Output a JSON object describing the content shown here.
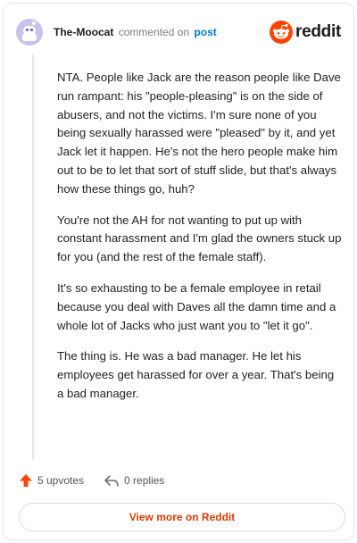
{
  "header": {
    "author": "The-Moocat",
    "action": "commented on",
    "post_link": "post",
    "brand": "reddit",
    "avatar_icon": "snoo-avatar-icon",
    "brand_icon": "reddit-logo-icon"
  },
  "comment": {
    "paragraphs": [
      "NTA. People like Jack are the reason people like Dave run rampant: his \"people-pleasing\" is on the side of abusers, and not the victims. I'm sure none of you being sexually harassed were \"pleased\" by it, and yet Jack let it happen. He's not the hero people make him out to be to let that sort of stuff slide, but that's always how these things go, huh?",
      "You're not the AH for not wanting to put up with constant harassment and I'm glad the owners stuck up for you (and the rest of the female staff).",
      "It's so exhausting to be a female employee in retail because you deal with Daves all the damn time and a whole lot of Jacks who just want you to \"let it go\".",
      "The thing is. He was a bad manager. He let his employees get harassed for over a year. That's being a bad manager."
    ]
  },
  "footer": {
    "upvotes": "5 upvotes",
    "replies": "0 replies",
    "upvote_icon": "upvote-arrow-icon",
    "reply_icon": "reply-arrow-icon",
    "view_more": "View more on Reddit"
  },
  "colors": {
    "accent": "#ff4500",
    "link": "#0079d3",
    "view_more_text": "#d93a00"
  }
}
